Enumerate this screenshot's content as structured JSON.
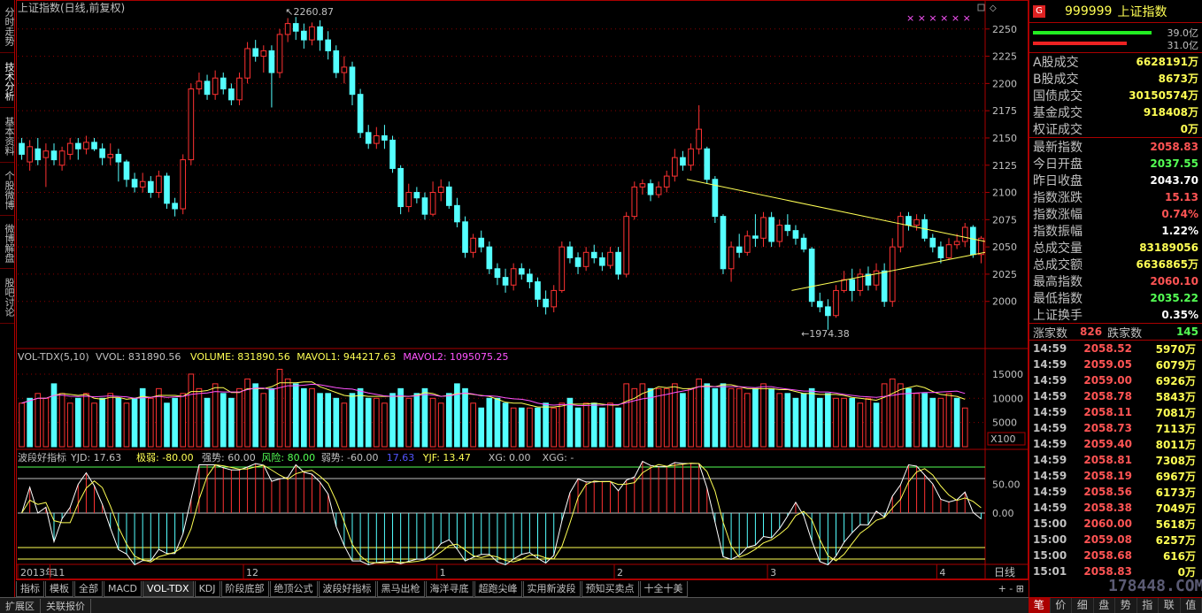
{
  "left_nav": [
    "分时走势",
    "技术分析",
    "基本资料",
    "个股微博",
    "微博解盘",
    "股吧讨论"
  ],
  "chart_data": {
    "type": "candlestick",
    "title": "上证指数(日线,前复权)",
    "ylim": [
      1960,
      2262
    ],
    "y_ticks": [
      2000,
      2025,
      2050,
      2075,
      2100,
      2125,
      2150,
      2175,
      2200,
      2225,
      2250
    ],
    "x_labels": [
      "2013年",
      "11",
      "12",
      "1",
      "2",
      "3",
      "4"
    ],
    "x_label_index": [
      0,
      4,
      28,
      52,
      74,
      93,
      114
    ],
    "high_label": "2260.87",
    "low_label": "1974.38",
    "candles": [
      [
        2145,
        2135,
        2150,
        2130
      ],
      [
        2128,
        2142,
        2148,
        2120
      ],
      [
        2140,
        2130,
        2150,
        2125
      ],
      [
        2132,
        2138,
        2145,
        2105
      ],
      [
        2138,
        2130,
        2145,
        2125
      ],
      [
        2125,
        2138,
        2142,
        2120
      ],
      [
        2135,
        2145,
        2150,
        2130
      ],
      [
        2145,
        2140,
        2150,
        2130
      ],
      [
        2140,
        2146,
        2152,
        2135
      ],
      [
        2146,
        2140,
        2150,
        2138
      ],
      [
        2140,
        2132,
        2145,
        2125
      ],
      [
        2132,
        2135,
        2145,
        2125
      ],
      [
        2135,
        2128,
        2140,
        2110
      ],
      [
        2128,
        2112,
        2130,
        2105
      ],
      [
        2112,
        2105,
        2118,
        2100
      ],
      [
        2105,
        2110,
        2118,
        2100
      ],
      [
        2110,
        2100,
        2115,
        2095
      ],
      [
        2100,
        2115,
        2120,
        2095
      ],
      [
        2115,
        2090,
        2118,
        2085
      ],
      [
        2090,
        2085,
        2095,
        2078
      ],
      [
        2085,
        2130,
        2135,
        2080
      ],
      [
        2130,
        2195,
        2200,
        2125
      ],
      [
        2195,
        2202,
        2210,
        2190
      ],
      [
        2202,
        2190,
        2208,
        2185
      ],
      [
        2190,
        2205,
        2212,
        2185
      ],
      [
        2205,
        2195,
        2210,
        2190
      ],
      [
        2195,
        2185,
        2200,
        2180
      ],
      [
        2185,
        2205,
        2210,
        2180
      ],
      [
        2205,
        2232,
        2238,
        2200
      ],
      [
        2232,
        2225,
        2240,
        2220
      ],
      [
        2225,
        2230,
        2235,
        2210
      ],
      [
        2230,
        2210,
        2235,
        2178
      ],
      [
        2210,
        2245,
        2250,
        2205
      ],
      [
        2245,
        2255,
        2260,
        2238
      ],
      [
        2255,
        2248,
        2261,
        2240
      ],
      [
        2248,
        2240,
        2255,
        2232
      ],
      [
        2240,
        2252,
        2256,
        2235
      ],
      [
        2252,
        2240,
        2258,
        2230
      ],
      [
        2240,
        2230,
        2248,
        2222
      ],
      [
        2230,
        2210,
        2235,
        2205
      ],
      [
        2210,
        2215,
        2225,
        2200
      ],
      [
        2215,
        2190,
        2220,
        2180
      ],
      [
        2190,
        2155,
        2195,
        2150
      ],
      [
        2155,
        2145,
        2162,
        2140
      ],
      [
        2145,
        2152,
        2160,
        2140
      ],
      [
        2152,
        2148,
        2162,
        2140
      ],
      [
        2148,
        2122,
        2152,
        2118
      ],
      [
        2122,
        2087,
        2125,
        2080
      ],
      [
        2087,
        2100,
        2108,
        2082
      ],
      [
        2100,
        2095,
        2105,
        2090
      ],
      [
        2095,
        2080,
        2100,
        2075
      ],
      [
        2080,
        2100,
        2110,
        2078
      ],
      [
        2100,
        2105,
        2112,
        2092
      ],
      [
        2105,
        2088,
        2110,
        2085
      ],
      [
        2088,
        2073,
        2095,
        2068
      ],
      [
        2073,
        2045,
        2078,
        2040
      ],
      [
        2045,
        2058,
        2062,
        2040
      ],
      [
        2058,
        2050,
        2065,
        2045
      ],
      [
        2050,
        2030,
        2055,
        2025
      ],
      [
        2030,
        2022,
        2035,
        2015
      ],
      [
        2022,
        2015,
        2030,
        2008
      ],
      [
        2015,
        2030,
        2035,
        2010
      ],
      [
        2030,
        2025,
        2035,
        2020
      ],
      [
        2025,
        2018,
        2030,
        2012
      ],
      [
        2018,
        2002,
        2022,
        1995
      ],
      [
        2002,
        1995,
        2010,
        1988
      ],
      [
        1995,
        2010,
        2015,
        1990
      ],
      [
        2010,
        2050,
        2055,
        2008
      ],
      [
        2050,
        2040,
        2055,
        2035
      ],
      [
        2040,
        2032,
        2045,
        2025
      ],
      [
        2032,
        2045,
        2050,
        2028
      ],
      [
        2045,
        2040,
        2052,
        2035
      ],
      [
        2040,
        2033,
        2045,
        2028
      ],
      [
        2033,
        2045,
        2050,
        2030
      ],
      [
        2045,
        2025,
        2050,
        2020
      ],
      [
        2025,
        2078,
        2082,
        2022
      ],
      [
        2078,
        2105,
        2110,
        2075
      ],
      [
        2105,
        2108,
        2112,
        2098
      ],
      [
        2108,
        2098,
        2112,
        2092
      ],
      [
        2098,
        2105,
        2110,
        2095
      ],
      [
        2105,
        2115,
        2120,
        2100
      ],
      [
        2115,
        2132,
        2140,
        2110
      ],
      [
        2132,
        2125,
        2138,
        2120
      ],
      [
        2125,
        2140,
        2145,
        2120
      ],
      [
        2140,
        2158,
        2180,
        2135
      ],
      [
        2140,
        2112,
        2142,
        2108
      ],
      [
        2112,
        2078,
        2115,
        2072
      ],
      [
        2078,
        2030,
        2080,
        2025
      ],
      [
        2030,
        2050,
        2055,
        2018
      ],
      [
        2050,
        2045,
        2062,
        2040
      ],
      [
        2045,
        2060,
        2065,
        2042
      ],
      [
        2060,
        2058,
        2080,
        2050
      ],
      [
        2058,
        2077,
        2082,
        2050
      ],
      [
        2077,
        2055,
        2082,
        2050
      ],
      [
        2055,
        2070,
        2075,
        2050
      ],
      [
        2070,
        2065,
        2080,
        2060
      ],
      [
        2065,
        2058,
        2070,
        2052
      ],
      [
        2058,
        2048,
        2062,
        2045
      ],
      [
        2048,
        2000,
        2050,
        1995
      ],
      [
        2000,
        1995,
        2008,
        1990
      ],
      [
        1995,
        1987,
        2002,
        1974
      ],
      [
        1987,
        2010,
        2015,
        1985
      ],
      [
        2010,
        2020,
        2028,
        2008
      ],
      [
        2020,
        2010,
        2030,
        2000
      ],
      [
        2010,
        2025,
        2030,
        2005
      ],
      [
        2025,
        2015,
        2032,
        2010
      ],
      [
        2015,
        2028,
        2035,
        2010
      ],
      [
        2028,
        2000,
        2035,
        1995
      ],
      [
        2000,
        2050,
        2058,
        1995
      ],
      [
        2050,
        2078,
        2082,
        2045
      ],
      [
        2078,
        2070,
        2082,
        2065
      ],
      [
        2070,
        2075,
        2080,
        2065
      ],
      [
        2075,
        2058,
        2080,
        2055
      ],
      [
        2058,
        2050,
        2062,
        2045
      ],
      [
        2050,
        2040,
        2055,
        2035
      ],
      [
        2040,
        2052,
        2058,
        2038
      ],
      [
        2052,
        2055,
        2062,
        2048
      ],
      [
        2055,
        2068,
        2072,
        2050
      ],
      [
        2068,
        2043,
        2070,
        2040
      ],
      [
        2043,
        2058,
        2060,
        2035
      ]
    ],
    "volume": [
      [
        9,
        1
      ],
      [
        10,
        0
      ],
      [
        11,
        1
      ],
      [
        10,
        1
      ],
      [
        13,
        0
      ],
      [
        11,
        1
      ],
      [
        9,
        1
      ],
      [
        10,
        0
      ],
      [
        11,
        1
      ],
      [
        9,
        1
      ],
      [
        10,
        0
      ],
      [
        11,
        1
      ],
      [
        10,
        0
      ],
      [
        9,
        1
      ],
      [
        10,
        0
      ],
      [
        12,
        0
      ],
      [
        10,
        1
      ],
      [
        12,
        1
      ],
      [
        9,
        0
      ],
      [
        10,
        0
      ],
      [
        11,
        1
      ],
      [
        15,
        1
      ],
      [
        12,
        1
      ],
      [
        10,
        0
      ],
      [
        13,
        1
      ],
      [
        11,
        0
      ],
      [
        10,
        0
      ],
      [
        12,
        1
      ],
      [
        14,
        1
      ],
      [
        13,
        0
      ],
      [
        11,
        1
      ],
      [
        12,
        0
      ],
      [
        16,
        1
      ],
      [
        14,
        1
      ],
      [
        13,
        0
      ],
      [
        12,
        0
      ],
      [
        12,
        1
      ],
      [
        11,
        0
      ],
      [
        11,
        0
      ],
      [
        10,
        0
      ],
      [
        9,
        1
      ],
      [
        11,
        0
      ],
      [
        12,
        0
      ],
      [
        10,
        0
      ],
      [
        10,
        1
      ],
      [
        9,
        1
      ],
      [
        11,
        0
      ],
      [
        12,
        0
      ],
      [
        10,
        1
      ],
      [
        11,
        0
      ],
      [
        12,
        0
      ],
      [
        10,
        1
      ],
      [
        9,
        1
      ],
      [
        11,
        0
      ],
      [
        13,
        0
      ],
      [
        12,
        0
      ],
      [
        9,
        1
      ],
      [
        8,
        0
      ],
      [
        10,
        0
      ],
      [
        10,
        0
      ],
      [
        9,
        0
      ],
      [
        8,
        1
      ],
      [
        8,
        0
      ],
      [
        8,
        1
      ],
      [
        8,
        0
      ],
      [
        9,
        0
      ],
      [
        8,
        1
      ],
      [
        9,
        1
      ],
      [
        10,
        0
      ],
      [
        8,
        0
      ],
      [
        9,
        1
      ],
      [
        9,
        0
      ],
      [
        8,
        0
      ],
      [
        9,
        1
      ],
      [
        8,
        0
      ],
      [
        13,
        1
      ],
      [
        12,
        1
      ],
      [
        13,
        1
      ],
      [
        12,
        0
      ],
      [
        12,
        1
      ],
      [
        12,
        1
      ],
      [
        13,
        1
      ],
      [
        11,
        0
      ],
      [
        12,
        1
      ],
      [
        14,
        1
      ],
      [
        13,
        0
      ],
      [
        12,
        0
      ],
      [
        13,
        0
      ],
      [
        12,
        1
      ],
      [
        12,
        1
      ],
      [
        11,
        1
      ],
      [
        12,
        0
      ],
      [
        13,
        1
      ],
      [
        12,
        0
      ],
      [
        11,
        1
      ],
      [
        11,
        0
      ],
      [
        10,
        0
      ],
      [
        11,
        0
      ],
      [
        12,
        0
      ],
      [
        10,
        0
      ],
      [
        11,
        0
      ],
      [
        10,
        1
      ],
      [
        10,
        1
      ],
      [
        10,
        0
      ],
      [
        9,
        1
      ],
      [
        10,
        1
      ],
      [
        9,
        0
      ],
      [
        13,
        1
      ],
      [
        14,
        1
      ],
      [
        13,
        1
      ],
      [
        12,
        0
      ],
      [
        11,
        1
      ],
      [
        11,
        0
      ],
      [
        10,
        0
      ],
      [
        10,
        1
      ],
      [
        11,
        1
      ],
      [
        10,
        0
      ],
      [
        8,
        1
      ]
    ],
    "vol_title": "VOL-TDX(5,10)",
    "vol_fields": [
      {
        "label": "VVOL: 831890.56",
        "color": "#c0c0c0"
      },
      {
        "label": "VOLUME: 831890.56",
        "color": "#ffff54"
      },
      {
        "label": "MAVOL1: 944217.63",
        "color": "#ffff54"
      },
      {
        "label": "MAVOL2: 1095075.25",
        "color": "#ff54ff"
      }
    ],
    "vol_ticks": [
      "15000",
      "10000",
      "5000"
    ],
    "vol_unit": "X100",
    "osc_title": "波段好指标",
    "osc_fields": [
      {
        "label": "YJD: 17.63",
        "color": "#c0c0c0"
      },
      {
        "label": "极弱: -80.00",
        "color": "#ffff54"
      },
      {
        "label": "强势: 60.00",
        "color": "#c0c0c0"
      },
      {
        "label": "风险: 80.00",
        "color": "#54ff54"
      },
      {
        "label": "弱势: -60.00",
        "color": "#c0c0c0"
      },
      {
        "label": "17.63",
        "color": "#5454ff"
      },
      {
        "label": "YJF: 13.47",
        "color": "#ffff54"
      },
      {
        "label": "XG: 0.00",
        "color": "#c0c0c0"
      },
      {
        "label": "XGG: -",
        "color": "#c0c0c0"
      }
    ],
    "osc_ticks": [
      "50.00",
      "0.00"
    ]
  },
  "right_panel": {
    "logo": "G",
    "code": "999999",
    "name": "上证指数",
    "bar_top_val": "39.0亿",
    "bar_bot_val": "31.0亿",
    "stats_a": [
      {
        "label": "A股成交",
        "value": "6628191万",
        "color": "#ffff54"
      },
      {
        "label": "B股成交",
        "value": "8673万",
        "color": "#ffff54"
      },
      {
        "label": "国债成交",
        "value": "30150574万",
        "color": "#ffff54"
      },
      {
        "label": "基金成交",
        "value": "918408万",
        "color": "#ffff54"
      },
      {
        "label": "权证成交",
        "value": "0万",
        "color": "#ffff54"
      }
    ],
    "stats_b": [
      {
        "label": "最新指数",
        "value": "2058.83",
        "color": "#ff5454"
      },
      {
        "label": "今日开盘",
        "value": "2037.55",
        "color": "#54ff54"
      },
      {
        "label": "昨日收盘",
        "value": "2043.70",
        "color": "#ffffff"
      },
      {
        "label": "指数涨跌",
        "value": "15.13",
        "color": "#ff5454"
      },
      {
        "label": "指数涨幅",
        "value": "0.74%",
        "color": "#ff5454"
      },
      {
        "label": "指数振幅",
        "value": "1.22%",
        "color": "#ffffff"
      },
      {
        "label": "总成交量",
        "value": "83189056",
        "color": "#ffff54"
      },
      {
        "label": "总成交额",
        "value": "6636865万",
        "color": "#ffff54"
      },
      {
        "label": "最高指数",
        "value": "2060.10",
        "color": "#ff5454"
      },
      {
        "label": "最低指数",
        "value": "2035.22",
        "color": "#54ff54"
      },
      {
        "label": "上证换手",
        "value": "0.35%",
        "color": "#ffffff"
      }
    ],
    "up_label": "涨家数",
    "up_count": "826",
    "down_label": "跌家数",
    "down_count": "145",
    "ticks": [
      [
        "14:59",
        "2058.52",
        "5970万"
      ],
      [
        "14:59",
        "2059.05",
        "6079万"
      ],
      [
        "14:59",
        "2059.00",
        "6926万"
      ],
      [
        "14:59",
        "2058.78",
        "5843万"
      ],
      [
        "14:59",
        "2058.11",
        "7081万"
      ],
      [
        "14:59",
        "2058.73",
        "7113万"
      ],
      [
        "14:59",
        "2059.40",
        "8011万"
      ],
      [
        "14:59",
        "2058.81",
        "7308万"
      ],
      [
        "14:59",
        "2058.19",
        "6967万"
      ],
      [
        "14:59",
        "2058.56",
        "6173万"
      ],
      [
        "14:59",
        "2058.38",
        "7049万"
      ],
      [
        "15:00",
        "2060.00",
        "5618万"
      ],
      [
        "15:00",
        "2059.08",
        "6257万"
      ],
      [
        "15:00",
        "2058.68",
        "616万"
      ],
      [
        "15:01",
        "2058.83",
        "0万"
      ]
    ],
    "foot_tabs": [
      "笔",
      "价",
      "细",
      "盘",
      "势",
      "指",
      "联",
      "值"
    ]
  },
  "bottom_tabs": [
    "指标",
    "模板",
    "全部",
    "MACD",
    "VOL-TDX",
    "KDJ",
    "阶段底部",
    "绝顶公式",
    "波段好指标",
    "黑马出枪",
    "海洋寻底",
    "超跑尖峰",
    "实用新波段",
    "预知买卖点",
    "十全十美"
  ],
  "bottom_ctrl": "+ - ⊞",
  "period_label": "日线",
  "status_bar": [
    "扩展区",
    "关联报价"
  ],
  "watermark": "178448.COM",
  "colors": {
    "up": "#ff3232",
    "down": "#54ffff",
    "grid": "#8b0000",
    "trend": "#ffff54"
  }
}
